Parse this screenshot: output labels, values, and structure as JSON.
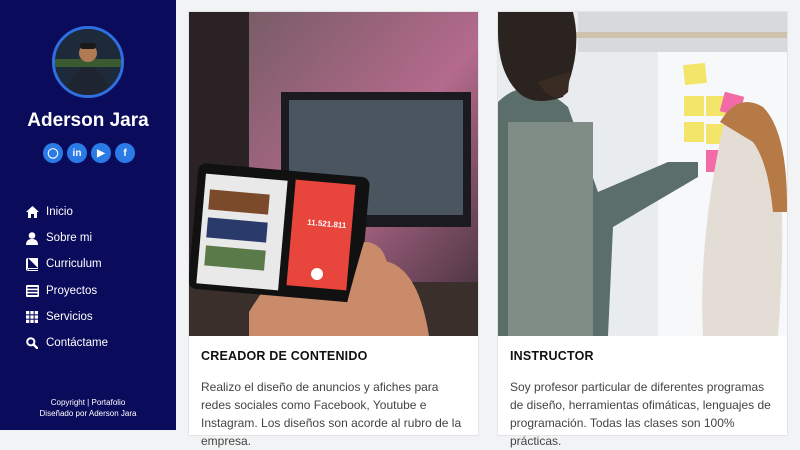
{
  "profile": {
    "name": "Aderson Jara",
    "socials": [
      {
        "icon": "github-icon",
        "glyph": "◯"
      },
      {
        "icon": "linkedin-icon",
        "glyph": "in"
      },
      {
        "icon": "youtube-icon",
        "glyph": "▶"
      },
      {
        "icon": "facebook-icon",
        "glyph": "f"
      }
    ]
  },
  "nav": [
    {
      "label": "Inicio",
      "icon": "home-icon"
    },
    {
      "label": "Sobre mi",
      "icon": "user-icon"
    },
    {
      "label": "Curriculum",
      "icon": "book-icon"
    },
    {
      "label": "Proyectos",
      "icon": "list-icon"
    },
    {
      "label": "Servicios",
      "icon": "grid-icon"
    },
    {
      "label": "Contáctame",
      "icon": "search-icon"
    }
  ],
  "footer": {
    "line1": "Copyright | Portafolio",
    "line2": "Diseñado por Aderson Jara"
  },
  "cards": [
    {
      "title": "CREADOR DE CONTENIDO",
      "text": "Realizo el diseño de anuncios y afiches para redes sociales como Facebook, Youtube e Instagram. Los diseños son acorde al rubro de la empresa.",
      "image_label": "11.521.811"
    },
    {
      "title": "INSTRUCTOR",
      "text": "Soy profesor particular de diferentes programas de diseño, herramientas ofimáticas, lenguajes de programación. Todas las clases son 100% prácticas."
    }
  ],
  "colors": {
    "sidebar": "#0b0b5c",
    "accent": "#2b7be6"
  }
}
